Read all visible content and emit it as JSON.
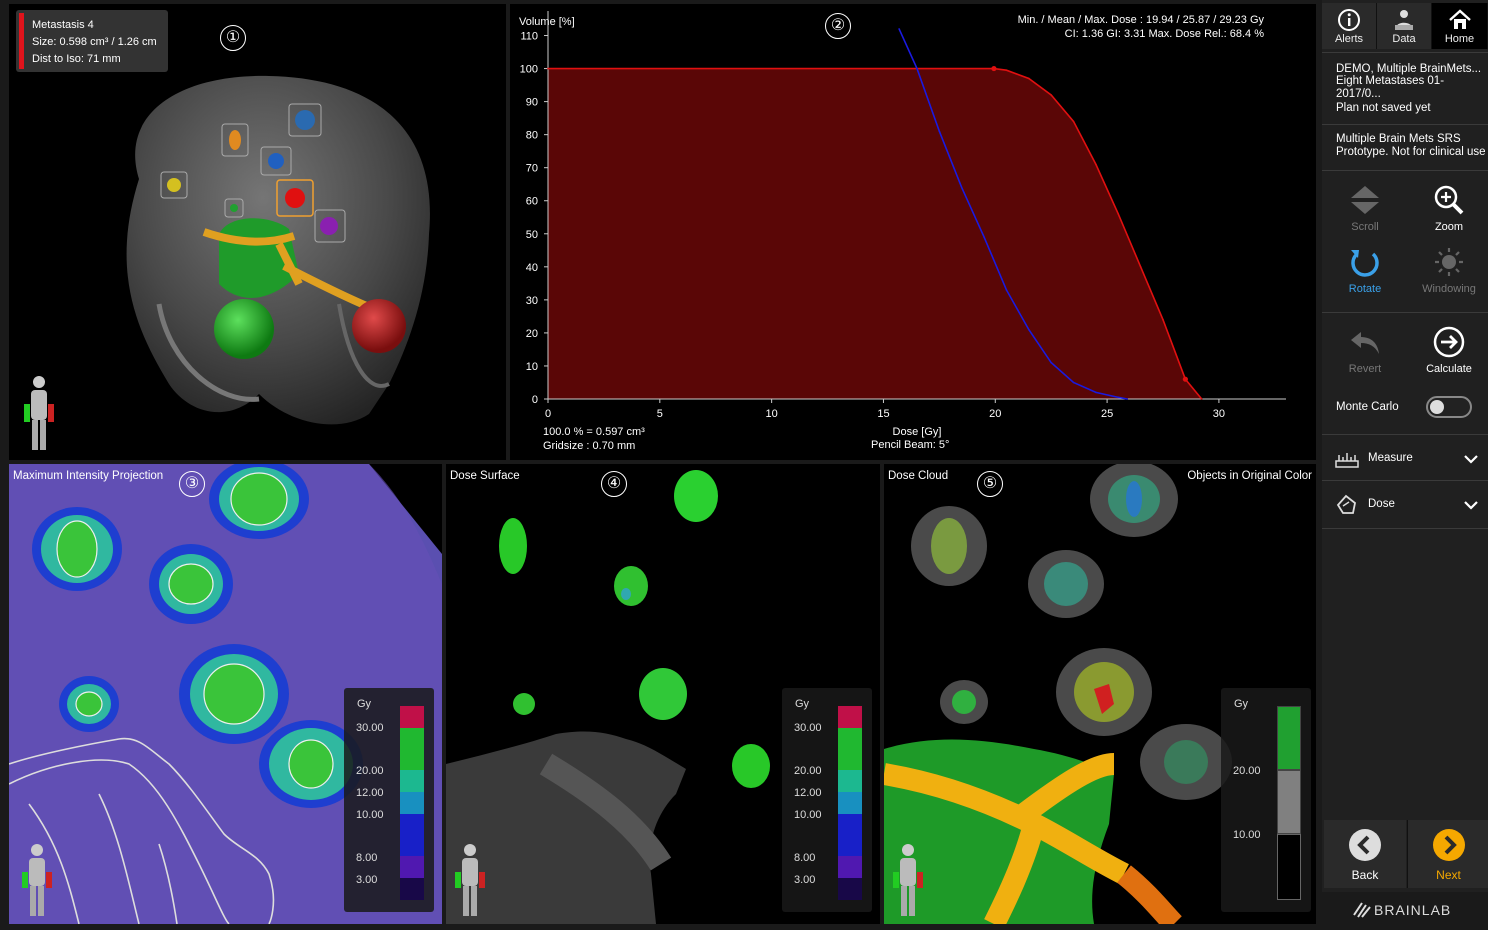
{
  "panel1": {
    "number": "①",
    "info": {
      "name": "Metastasis 4",
      "size": "Size: 0.598 cm³ / 1.26 cm",
      "dist": "Dist to Iso: 71 mm"
    }
  },
  "panel2": {
    "number": "②",
    "stats_line1": "Min. / Mean / Max. Dose : 19.94 / 25.87 / 29.23 Gy",
    "stats_line2": "CI: 1.36  GI: 3.31  Max. Dose Rel.: 68.4 %",
    "footer_volume": "100.0 % = 0.597 cm³",
    "footer_grid": "Gridsize : 0.70 mm",
    "footer_beam": "Pencil Beam: 5°"
  },
  "panel3": {
    "number": "③",
    "title": "Maximum Intensity Projection"
  },
  "panel4": {
    "number": "④",
    "title": "Dose Surface"
  },
  "panel5": {
    "number": "⑤",
    "title": "Dose Cloud",
    "right_title": "Objects in Original Color"
  },
  "colorbar_full": {
    "unit": "Gy",
    "labels": [
      "30.00",
      "20.00",
      "12.00",
      "10.00",
      "8.00",
      "3.00"
    ]
  },
  "colorbar_cloud": {
    "unit": "Gy",
    "labels": [
      "20.00",
      "10.00"
    ]
  },
  "chart_data": {
    "type": "line",
    "title": "",
    "xlabel": "Dose [Gy]",
    "ylabel": "Volume [%]",
    "xlim": [
      0,
      33
    ],
    "ylim": [
      0,
      115
    ],
    "xticks": [
      0,
      5,
      10,
      15,
      20,
      25,
      30
    ],
    "yticks": [
      0,
      10,
      20,
      30,
      40,
      50,
      60,
      70,
      80,
      90,
      100,
      110
    ],
    "series": [
      {
        "color": "#e01010",
        "fill": "#5a0606",
        "x": [
          0,
          19.94,
          20.5,
          21.5,
          22.5,
          23.5,
          24.5,
          25.5,
          26.5,
          27.5,
          28.5,
          29.23
        ],
        "y": [
          100,
          100,
          99.5,
          97,
          92,
          84,
          71,
          56,
          40,
          24,
          6,
          0
        ]
      },
      {
        "color": "#1a1ae0",
        "x": [
          15.7,
          16.5,
          17.5,
          18.5,
          19.5,
          20.5,
          21.5,
          22.5,
          23.5,
          24.5,
          25.5,
          25.9
        ],
        "y": [
          112,
          100,
          81,
          64,
          49,
          33,
          21,
          11,
          5,
          2,
          0.5,
          0
        ]
      }
    ]
  },
  "sidebar": {
    "nav": [
      {
        "label": "Alerts",
        "icon": "info-icon"
      },
      {
        "label": "Data",
        "icon": "patient-data-icon"
      },
      {
        "label": "Home",
        "icon": "home-icon"
      }
    ],
    "patient_line1": "DEMO, Multiple BrainMets...",
    "patient_line2": "Eight Metastases 01-2017/0...",
    "plan_status": "Plan not saved yet",
    "product_line1": "Multiple Brain Mets SRS",
    "product_line2": "Prototype. Not for clinical use",
    "tools": {
      "scroll": "Scroll",
      "zoom": "Zoom",
      "rotate": "Rotate",
      "windowing": "Windowing",
      "revert": "Revert",
      "calculate": "Calculate"
    },
    "monte_carlo": "Monte Carlo",
    "monte_carlo_enabled": false,
    "measure": "Measure",
    "dose": "Dose",
    "back": "Back",
    "next": "Next",
    "brand": "BRAINLAB",
    "accent": "#f5a800",
    "active_blue": "#3aa0e8"
  }
}
